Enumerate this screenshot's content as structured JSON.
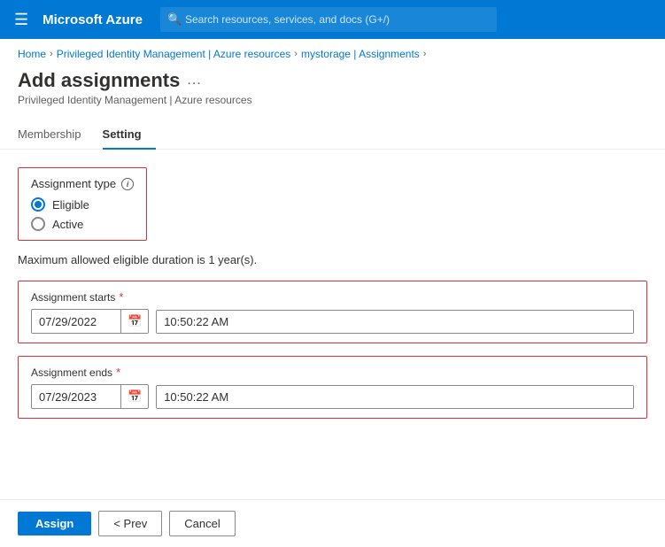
{
  "nav": {
    "hamburger_icon": "☰",
    "brand": "Microsoft Azure",
    "search_placeholder": "Search resources, services, and docs (G+/)"
  },
  "breadcrumb": {
    "home": "Home",
    "pim": "Privileged Identity Management | Azure resources",
    "storage": "mystorage | Assignments"
  },
  "page": {
    "title": "Add assignments",
    "ellipsis": "...",
    "subtitle": "Privileged Identity Management | Azure resources"
  },
  "tabs": [
    {
      "label": "Membership",
      "active": false
    },
    {
      "label": "Setting",
      "active": true
    }
  ],
  "assignment_type": {
    "label": "Assignment type",
    "options": [
      {
        "label": "Eligible",
        "checked": true
      },
      {
        "label": "Active",
        "checked": false
      }
    ]
  },
  "info_text": "Maximum allowed eligible duration is 1 year(s).",
  "assignment_starts": {
    "label": "Assignment starts",
    "date_value": "07/29/2022",
    "time_value": "10:50:22 AM"
  },
  "assignment_ends": {
    "label": "Assignment ends",
    "date_value": "07/29/2023",
    "time_value": "10:50:22 AM"
  },
  "footer": {
    "assign_label": "Assign",
    "prev_label": "< Prev",
    "cancel_label": "Cancel"
  }
}
